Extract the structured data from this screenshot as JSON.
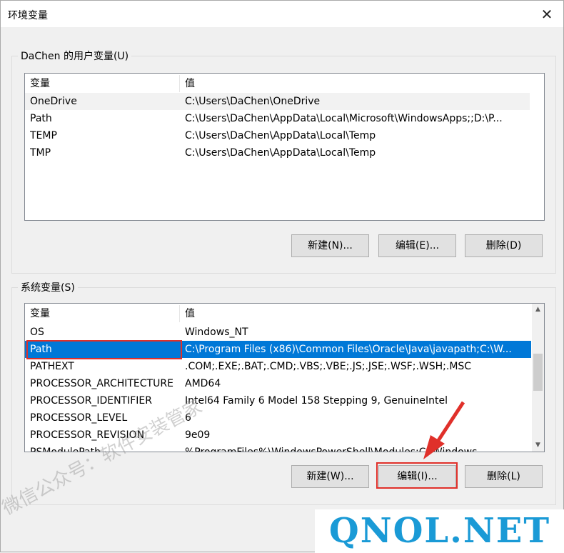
{
  "window": {
    "title": "环境变量",
    "close_icon": "close-icon"
  },
  "user_vars": {
    "group_label": "DaChen 的用户变量(U)",
    "header": {
      "name": "变量",
      "value": "值"
    },
    "rows": [
      {
        "name": "OneDrive",
        "value": "C:\\Users\\DaChen\\OneDrive"
      },
      {
        "name": "Path",
        "value": "C:\\Users\\DaChen\\AppData\\Local\\Microsoft\\WindowsApps;;D:\\P..."
      },
      {
        "name": "TEMP",
        "value": "C:\\Users\\DaChen\\AppData\\Local\\Temp"
      },
      {
        "name": "TMP",
        "value": "C:\\Users\\DaChen\\AppData\\Local\\Temp"
      }
    ],
    "buttons": {
      "new": "新建(N)...",
      "edit": "编辑(E)...",
      "delete": "删除(D)"
    }
  },
  "system_vars": {
    "group_label": "系统变量(S)",
    "header": {
      "name": "变量",
      "value": "值"
    },
    "rows": [
      {
        "name": "OS",
        "value": "Windows_NT"
      },
      {
        "name": "Path",
        "value": "C:\\Program Files (x86)\\Common Files\\Oracle\\Java\\javapath;C:\\W..."
      },
      {
        "name": "PATHEXT",
        "value": ".COM;.EXE;.BAT;.CMD;.VBS;.VBE;.JS;.JSE;.WSF;.WSH;.MSC"
      },
      {
        "name": "PROCESSOR_ARCHITECTURE",
        "value": "AMD64"
      },
      {
        "name": "PROCESSOR_IDENTIFIER",
        "value": "Intel64 Family 6 Model 158 Stepping 9, GenuineIntel"
      },
      {
        "name": "PROCESSOR_LEVEL",
        "value": "6"
      },
      {
        "name": "PROCESSOR_REVISION",
        "value": "9e09"
      },
      {
        "name": "PSModulePath",
        "value": "%ProgramFiles%\\WindowsPowerShell\\Modules;C:\\Windows..."
      }
    ],
    "selected_row": "Path",
    "buttons": {
      "new": "新建(W)...",
      "edit": "编辑(I)...",
      "delete": "删除(L)"
    }
  },
  "overlay": {
    "watermark": "微信公众号：软件安装管家",
    "logo": "QNOL.NET",
    "highlight_color": "#e0302a",
    "selection_color": "#0078d7"
  }
}
